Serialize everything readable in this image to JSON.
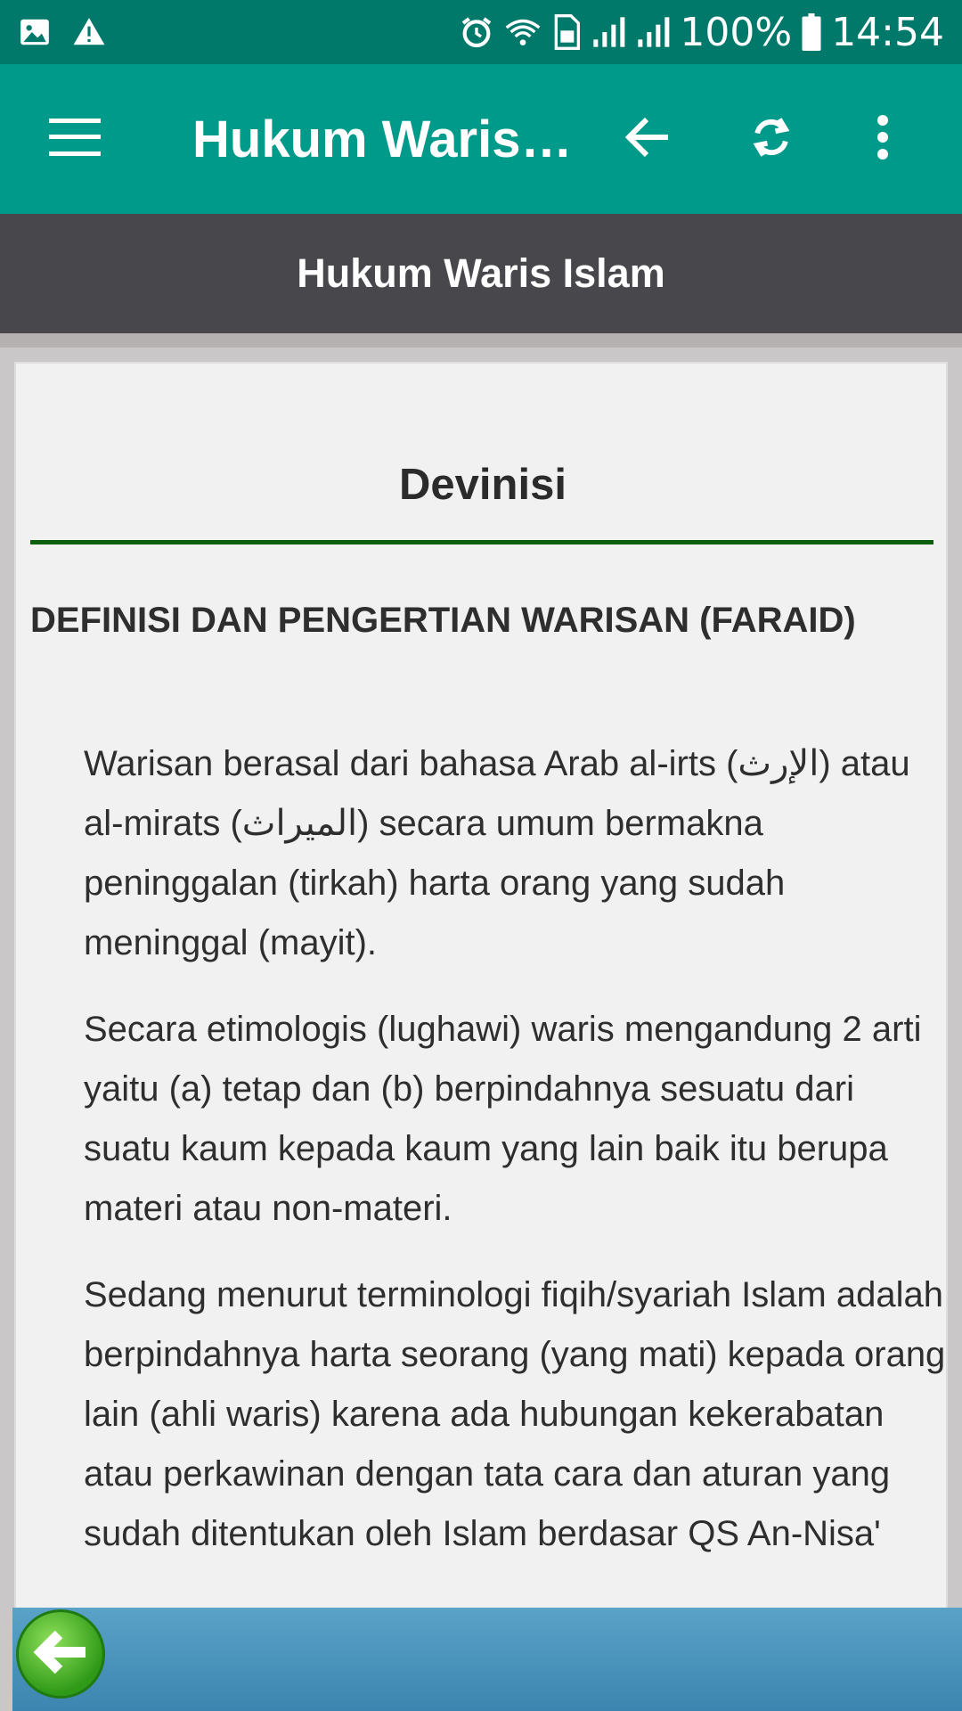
{
  "status_bar": {
    "battery": "100%",
    "time": "14:54"
  },
  "app_bar": {
    "title": "Hukum Waris I..."
  },
  "page_header": {
    "title": "Hukum Waris Islam"
  },
  "content": {
    "section_title": "Devinisi",
    "heading": "DEFINISI DAN PENGERTIAN WARISAN (FARAID)",
    "paragraphs": [
      "Warisan berasal dari bahasa Arab al-irts (الإرث) atau al-mirats (الميراث) secara umum bermakna peninggalan (tirkah) harta orang yang sudah meninggal (mayit).",
      "Secara etimologis (lughawi) waris mengandung 2 arti yaitu (a) tetap dan (b) berpindahnya sesuatu dari suatu kaum kepada kaum yang lain baik itu berupa materi atau non-materi.",
      "Sedang menurut terminologi fiqih/syariah Islam adalah berpindahnya harta seorang (yang mati) kepada orang lain (ahli waris) karena ada hubungan kekerabatan atau perkawinan dengan tata cara dan aturan yang sudah ditentukan oleh Islam berdasar QS An-Nisa'"
    ]
  },
  "colors": {
    "status_bar": "#00796b",
    "app_bar": "#009a8a",
    "header": "#48474c",
    "divider": "#0b5e0b",
    "bottom_bar": "#4a93bd"
  },
  "icons": {
    "status_left": [
      "image-icon",
      "warning-icon"
    ],
    "status_right": [
      "alarm-icon",
      "wifi-icon",
      "sim-icon",
      "signal-icon",
      "signal-icon",
      "battery-icon"
    ],
    "app_bar": [
      "menu-icon",
      "back-arrow-icon",
      "refresh-icon",
      "more-vert-icon"
    ],
    "bottom": [
      "back-fab-icon"
    ]
  }
}
